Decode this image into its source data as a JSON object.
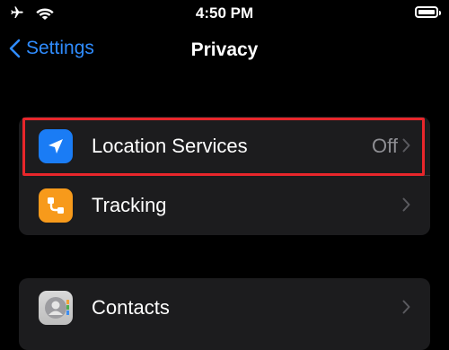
{
  "status_bar": {
    "time": "4:50 PM"
  },
  "nav": {
    "back_label": "Settings",
    "title": "Privacy"
  },
  "group_1": {
    "rows": [
      {
        "label": "Location Services",
        "value": "Off",
        "icon": "location-arrow-icon",
        "icon_color": "#1a7cf5"
      },
      {
        "label": "Tracking",
        "value": "",
        "icon": "tracking-icon",
        "icon_color": "#f79a1b"
      }
    ]
  },
  "group_2": {
    "rows": [
      {
        "label": "Contacts",
        "value": "",
        "icon": "contacts-icon",
        "icon_color": "#cfcfcf"
      }
    ]
  },
  "colors": {
    "accent": "#2f8cff",
    "highlight": "#e8262b",
    "cell_bg": "#1c1c1e"
  }
}
